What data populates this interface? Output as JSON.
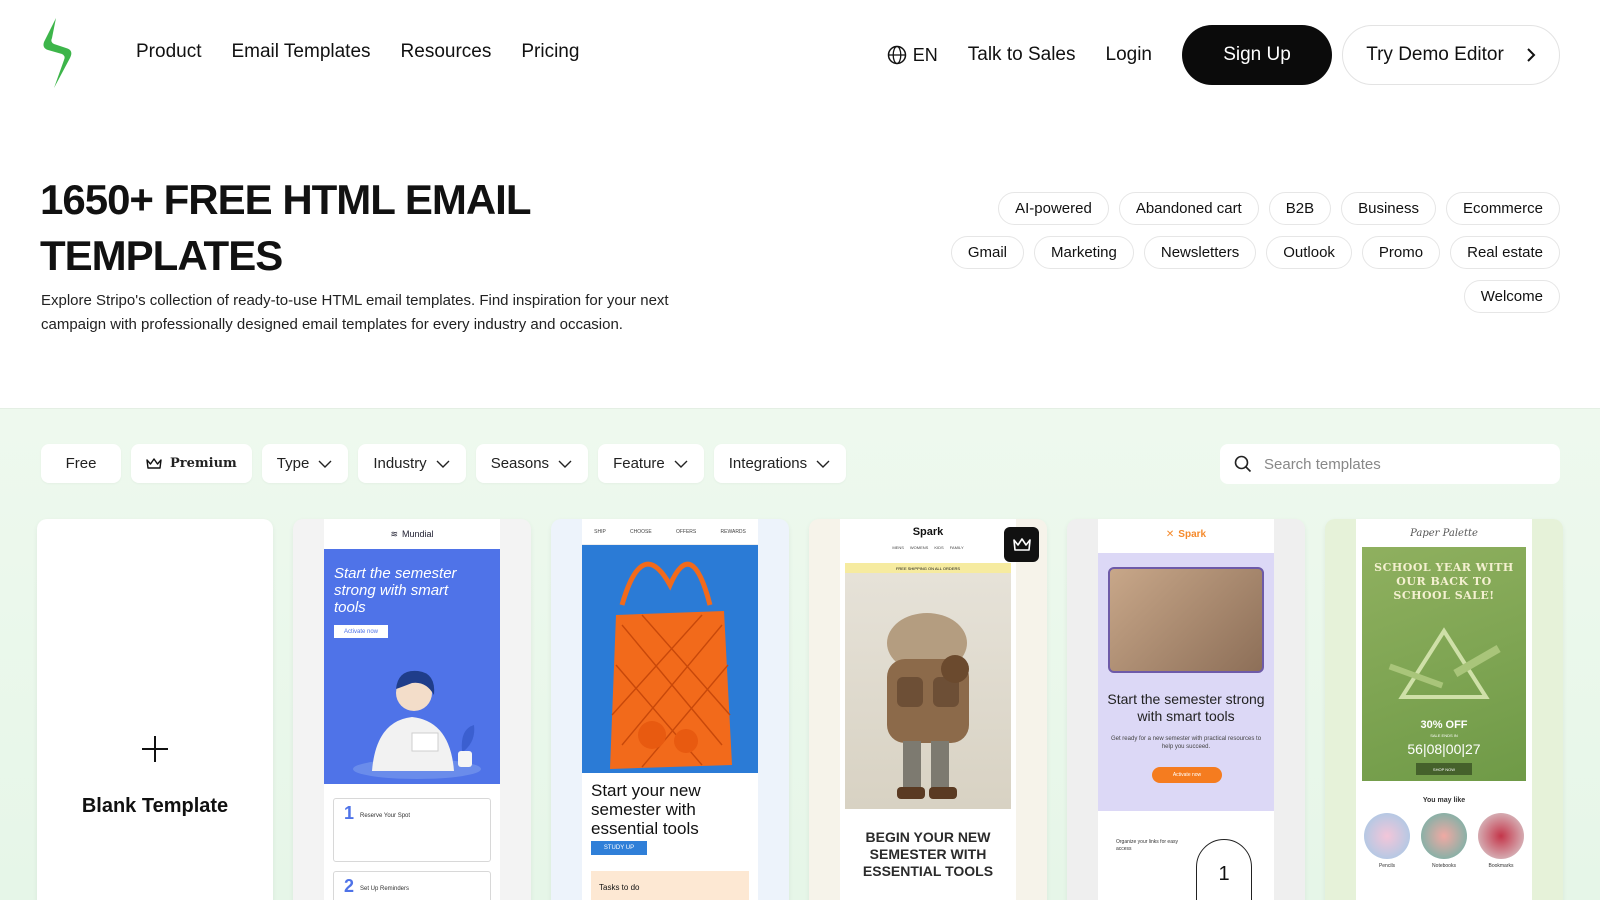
{
  "nav": {
    "links": [
      "Product",
      "Email Templates",
      "Resources",
      "Pricing"
    ],
    "lang": "EN",
    "talk_to_sales": "Talk to Sales",
    "login": "Login",
    "sign_up": "Sign Up",
    "try_demo": "Try Demo Editor"
  },
  "hero": {
    "title": "1650+ FREE HTML EMAIL TEMPLATES",
    "description": "Explore Stripo's collection of ready-to-use HTML email templates. Find inspiration for your next campaign with professionally designed email templates for every industry and occasion."
  },
  "tags": [
    "AI-powered",
    "Abandoned cart",
    "B2B",
    "Business",
    "Ecommerce",
    "Gmail",
    "Marketing",
    "Newsletters",
    "Outlook",
    "Promo",
    "Real estate",
    "Welcome"
  ],
  "filters": {
    "free": "Free",
    "premium": "Premium",
    "type": "Type",
    "industry": "Industry",
    "seasons": "Seasons",
    "feature": "Feature",
    "integrations": "Integrations"
  },
  "search": {
    "placeholder": "Search templates"
  },
  "blank": {
    "label": "Blank Template"
  },
  "templates": [
    {
      "brand": "Mundial",
      "title": "Start the semester strong with smart tools",
      "button": "Activate now",
      "steps": [
        {
          "num": "1",
          "label": "Reserve Your Spot"
        },
        {
          "num": "2",
          "label": "Set Up Reminders"
        }
      ]
    },
    {
      "menu": [
        "SHIP",
        "CHOOSE",
        "OFFERS",
        "REWARDS"
      ],
      "title": "Start your new semester with essential tools",
      "button": "STUDY UP",
      "tasks": "Tasks to do"
    },
    {
      "brand": "Spark",
      "menu": [
        "MENS",
        "WOMENS",
        "KIDS",
        "FAMILY"
      ],
      "shipping": "FREE SHIPPING ON ALL ORDERS",
      "title": "BEGIN YOUR NEW SEMESTER WITH ESSENTIAL TOOLS"
    },
    {
      "brand": "Spark",
      "title": "Start the semester strong with smart tools",
      "subtitle": "Get ready for a new semester with practical resources to help you succeed.",
      "button": "Activate now",
      "list": "Organize your links for easy access",
      "step": "1"
    },
    {
      "brand": "Paper Palette",
      "title": "SCHOOL YEAR WITH OUR BACK TO SCHOOL SALE!",
      "discount": "30% OFF",
      "ends": "SALE ENDS IN",
      "timer": "56|08|00|27",
      "button": "SHOP NOW",
      "you_may_like": "You may like",
      "products": [
        "Pencils",
        "Notebooks",
        "Bookmarks"
      ]
    }
  ],
  "colors": {
    "brand_green": "#3db54a",
    "listing_bg": "#eef9ee",
    "signup_bg": "#0b0b0b"
  }
}
